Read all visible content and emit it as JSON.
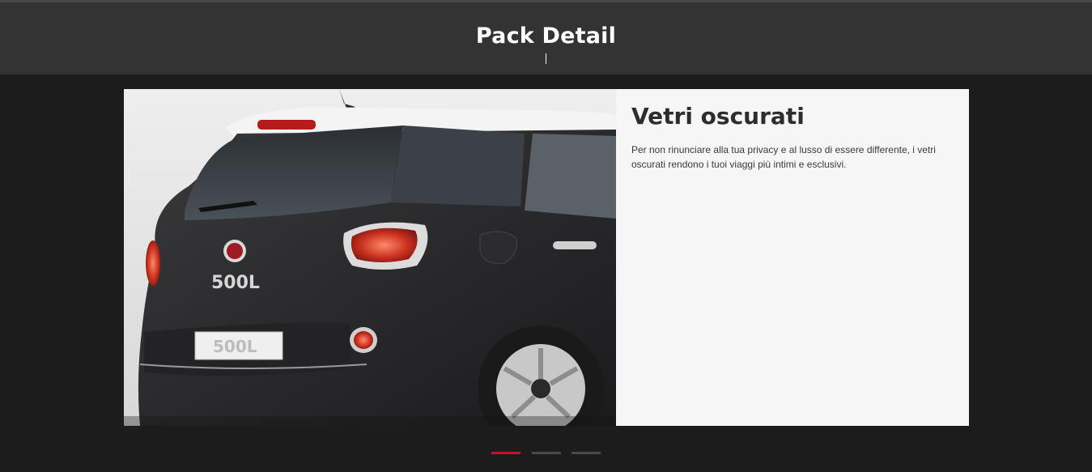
{
  "header": {
    "title": "Pack Detail"
  },
  "feature": {
    "title": "Vetri oscurati",
    "description": "Per non rinunciare alla tua privacy e al lusso di essere differente, i vetri oscurati rendono i tuoi viaggi più intimi e esclusivi.",
    "image_alt": "Fiat 500L rear view with tinted windows",
    "badge_text": "500L",
    "plate_text": "500L"
  },
  "pager": {
    "items": [
      {
        "label": "slide-1",
        "active": true
      },
      {
        "label": "slide-2",
        "active": false
      },
      {
        "label": "slide-3",
        "active": false
      }
    ],
    "active_color": "#c8102e",
    "inactive_color": "#4a4a4a"
  }
}
